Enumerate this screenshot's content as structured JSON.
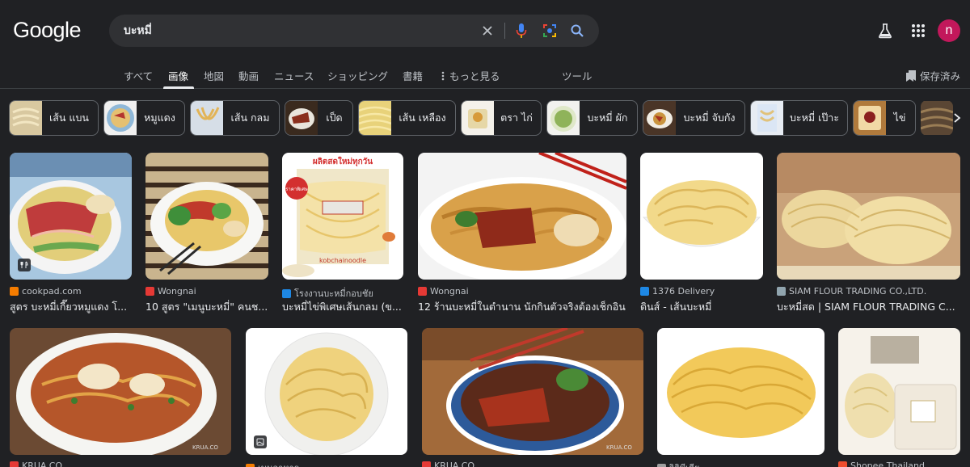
{
  "header": {
    "logo": "Google",
    "search_value": "บะหมี่",
    "avatar_letter": "n"
  },
  "tabs": [
    "すべて",
    "画像",
    "地図",
    "動画",
    "ニュース",
    "ショッピング",
    "書籍",
    "もっと見る",
    "ツール"
  ],
  "active_tab": "画像",
  "saved_label": "保存済み",
  "chips": [
    "เส้น แบน",
    "หมูแดง",
    "เส้น กลม",
    "เป็ด",
    "เส้น เหลือง",
    "ตรา ไก่",
    "บะหมี่ ผัก",
    "บะหมี่ จับกัง",
    "บะหมี่ เป๊าะ",
    "ไข่"
  ],
  "results_row1": [
    {
      "source": "cookpad.com",
      "title": "สูตร บะหมี่เกี๊ยวหมูแดง โ...",
      "fav_color": "#f57c00"
    },
    {
      "source": "Wongnai",
      "title": "10 สูตร \"เมนูบะหมี่\" คนช...",
      "fav_color": "#e53935"
    },
    {
      "source": "โรงงานบะหมี่กอบชัย",
      "title": "บะหมี่ไข่พิเศษเส้นกลม (ข...",
      "fav_color": "#1e88e5"
    },
    {
      "source": "Wongnai",
      "title": "12 ร้านบะหมี่ในตำนาน นักกินตัวจริงต้องเช็กอิน",
      "fav_color": "#e53935"
    },
    {
      "source": "1376 Delivery",
      "title": "ดินส์ - เส้นบะหมี่",
      "fav_color": "#1e88e5"
    },
    {
      "source": "SIAM FLOUR TRADING CO.,LTD.",
      "title": "บะหมี่สด | SIAM FLOUR TRADING C...",
      "fav_color": "#90a4ae"
    }
  ],
  "results_row2": [
    {
      "source": "KRUA.CO",
      "fav_color": "#e53935"
    },
    {
      "source": "เมนูอาหาร",
      "fav_color": "#f57c00"
    },
    {
      "source": "KRUA.CO",
      "fav_color": "#e53935"
    },
    {
      "source": "วิกิพีเดีย",
      "fav_color": "#9e9e9e"
    },
    {
      "source": "Shopee Thailand",
      "fav_color": "#ee4d2d"
    }
  ],
  "image_overlay_texts": {
    "bag_top": "ผลิตสดใหม่ทุกวัน",
    "bag_badge": "ราคาพิเศษ",
    "bag_brand": "kobchainoodle",
    "watermark": "KRUA.CO"
  },
  "colors": {
    "background": "#202124",
    "search_box": "#303134",
    "avatar": "#c2185b",
    "mic": "#4285f4",
    "text": "#e8eaed"
  },
  "icons": [
    "clear-icon",
    "microphone-icon",
    "lens-icon",
    "search-icon",
    "labs-flask-icon",
    "apps-grid-icon",
    "bookmark-icon",
    "more-vert-icon",
    "chevron-right-icon",
    "recipe-icon",
    "product-icon"
  ]
}
